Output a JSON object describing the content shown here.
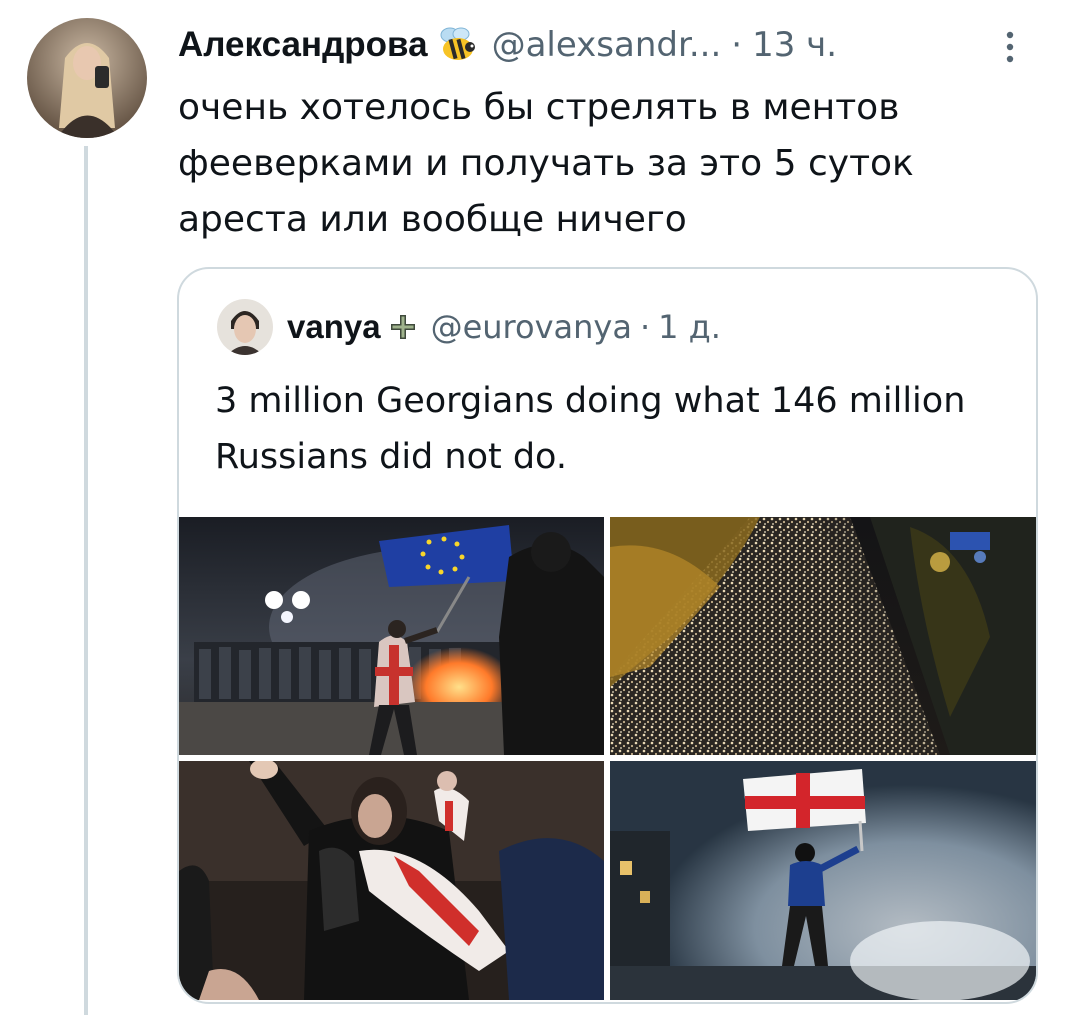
{
  "tweet": {
    "author_name": "Александрова",
    "handle": "@alexsandr...",
    "separator": "·",
    "time": "13 ч.",
    "badge_icon": "bee-icon",
    "text": "очень хотелось бы стрелять в ментов фееверками и получать за это 5 суток ареста или вообще ничего"
  },
  "quote": {
    "author_name": "vanya",
    "badge_icon": "cross-icon",
    "handle": "@eurovanya",
    "separator": "·",
    "time": "1 д.",
    "text": "3 million Georgians doing what 146 million Russians did not do."
  },
  "colors": {
    "text_primary": "#0f1419",
    "text_secondary": "#536471",
    "border": "#cfd9de"
  }
}
